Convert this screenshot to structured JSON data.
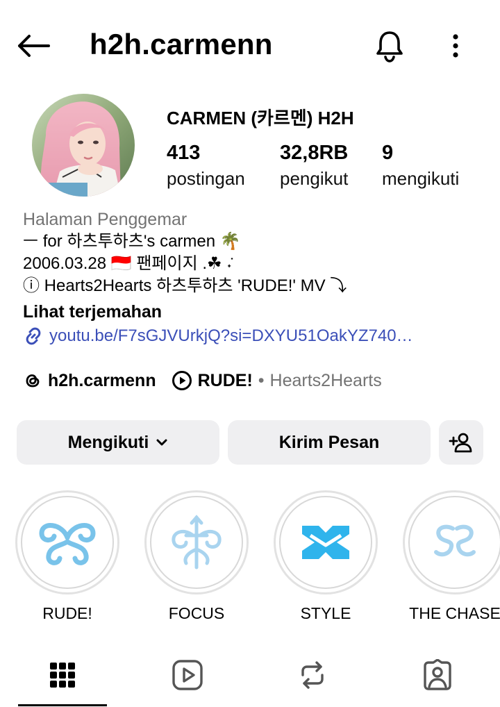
{
  "header": {
    "username": "h2h.carmenn",
    "icons": [
      "back-arrow-icon",
      "bell-icon",
      "more-vertical-icon"
    ]
  },
  "profile": {
    "display_name": "CARMEN (카르멘) H2H",
    "stats": [
      {
        "count": "413",
        "label": "postingan"
      },
      {
        "count": "32,8RB",
        "label": "pengikut"
      },
      {
        "count": "9",
        "label": "mengikuti"
      }
    ]
  },
  "bio": {
    "category": "Halaman Penggemar",
    "line1": "ㅡ for 하츠투하츠's carmen 🌴",
    "line2": "2006.03.28 🇮🇩 팬페이지 .☘︎ ݁˖",
    "line3": "ⓘ Hearts2Hearts 하츠투하츠 'RUDE!' MV ⤵",
    "translate": "Lihat terjemahan",
    "link": "youtu.be/F7sGJVUrkjQ?si=DXYU51OakYZ740…"
  },
  "badges": {
    "threads_handle": "h2h.carmenn",
    "music_title": "RUDE!",
    "music_separator": "•",
    "music_artist": "Hearts2Hearts"
  },
  "actions": {
    "following_label": "Mengikuti",
    "message_label": "Kirim Pesan"
  },
  "highlights": [
    {
      "label": "RUDE!"
    },
    {
      "label": "FOCUS"
    },
    {
      "label": "STYLE"
    },
    {
      "label": "THE CHASE"
    }
  ],
  "colors": {
    "link": "#3b4fb8",
    "muted": "#737373",
    "button_bg": "#efeff1",
    "highlight_blue": "#79c3ea",
    "highlight_light_blue": "#a9d4ef",
    "highlight_bright": "#2fb4ec"
  }
}
